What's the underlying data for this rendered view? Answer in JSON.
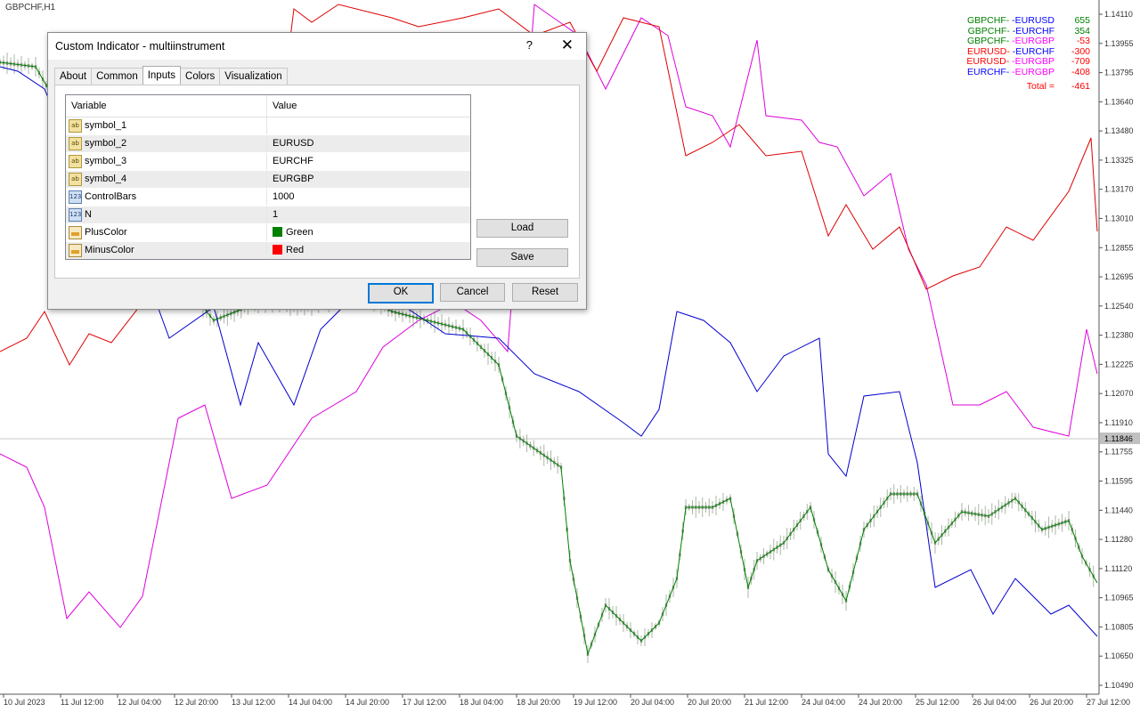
{
  "chart": {
    "title": "GBPCHF,H1",
    "current_price": "1.11846",
    "price_axis": [
      "1.14110",
      "1.13955",
      "1.13795",
      "1.13640",
      "1.13480",
      "1.13325",
      "1.13170",
      "1.13010",
      "1.12855",
      "1.12695",
      "1.12540",
      "1.12380",
      "1.12225",
      "1.12070",
      "1.11910",
      "1.11755",
      "1.11595",
      "1.11440",
      "1.11280",
      "1.11120",
      "1.10965",
      "1.10805",
      "1.10650",
      "1.10490"
    ],
    "time_axis": [
      "10 Jul 2023",
      "11 Jul 12:00",
      "12 Jul 04:00",
      "12 Jul 20:00",
      "13 Jul 12:00",
      "14 Jul 04:00",
      "14 Jul 20:00",
      "17 Jul 12:00",
      "18 Jul 04:00",
      "18 Jul 20:00",
      "19 Jul 12:00",
      "20 Jul 04:00",
      "20 Jul 20:00",
      "21 Jul 12:00",
      "24 Jul 04:00",
      "24 Jul 20:00",
      "25 Jul 12:00",
      "26 Jul 04:00",
      "26 Jul 20:00",
      "27 Jul 12:00"
    ],
    "colors": {
      "green": "#008000",
      "blue": "#0000cd",
      "magenta": "#dd00dd",
      "red": "#dd0000",
      "candles": "#aab8a4"
    }
  },
  "legend": {
    "rows": [
      {
        "a": "GBPCHF-",
        "b": "-EURUSD",
        "value": "655",
        "ca": "#008000",
        "cb": "#0000ff",
        "cv": "#008000"
      },
      {
        "a": "GBPCHF-",
        "b": "-EURCHF",
        "value": "354",
        "ca": "#008000",
        "cb": "#0000ff",
        "cv": "#008000"
      },
      {
        "a": "GBPCHF-",
        "b": "-EURGBP",
        "value": "-53",
        "ca": "#008000",
        "cb": "#ff00ff",
        "cv": "#ff0000"
      },
      {
        "a": "EURUSD-",
        "b": "-EURCHF",
        "value": "-300",
        "ca": "#ff0000",
        "cb": "#0000ff",
        "cv": "#ff0000"
      },
      {
        "a": "EURUSD-",
        "b": "-EURGBP",
        "value": "-709",
        "ca": "#ff0000",
        "cb": "#ff00ff",
        "cv": "#ff0000"
      },
      {
        "a": "EURCHF-",
        "b": "-EURGBP",
        "value": "-408",
        "ca": "#0000ff",
        "cb": "#ff00ff",
        "cv": "#ff0000"
      }
    ],
    "total_label": "Total  =",
    "total_value": "-461"
  },
  "dialog": {
    "title": "Custom Indicator - multiinstrument",
    "help": "?",
    "close": "✕",
    "tabs": [
      "About",
      "Common",
      "Inputs",
      "Colors",
      "Visualization"
    ],
    "active_tab": "Inputs",
    "grid": {
      "col_variable": "Variable",
      "col_value": "Value",
      "rows": [
        {
          "icon": "ab",
          "name": "symbol_1",
          "value": ""
        },
        {
          "icon": "ab",
          "name": "symbol_2",
          "value": "EURUSD"
        },
        {
          "icon": "ab",
          "name": "symbol_3",
          "value": "EURCHF"
        },
        {
          "icon": "ab",
          "name": "symbol_4",
          "value": "EURGBP"
        },
        {
          "icon": "123",
          "name": "ControlBars",
          "value": "1000"
        },
        {
          "icon": "123",
          "name": "N",
          "value": "1"
        },
        {
          "icon": "color",
          "name": "PlusColor",
          "value": "Green",
          "swatch": "#008000"
        },
        {
          "icon": "color",
          "name": "MinusColor",
          "value": "Red",
          "swatch": "#ff0000"
        }
      ]
    },
    "buttons": {
      "load": "Load",
      "save": "Save",
      "ok": "OK",
      "cancel": "Cancel",
      "reset": "Reset"
    }
  }
}
